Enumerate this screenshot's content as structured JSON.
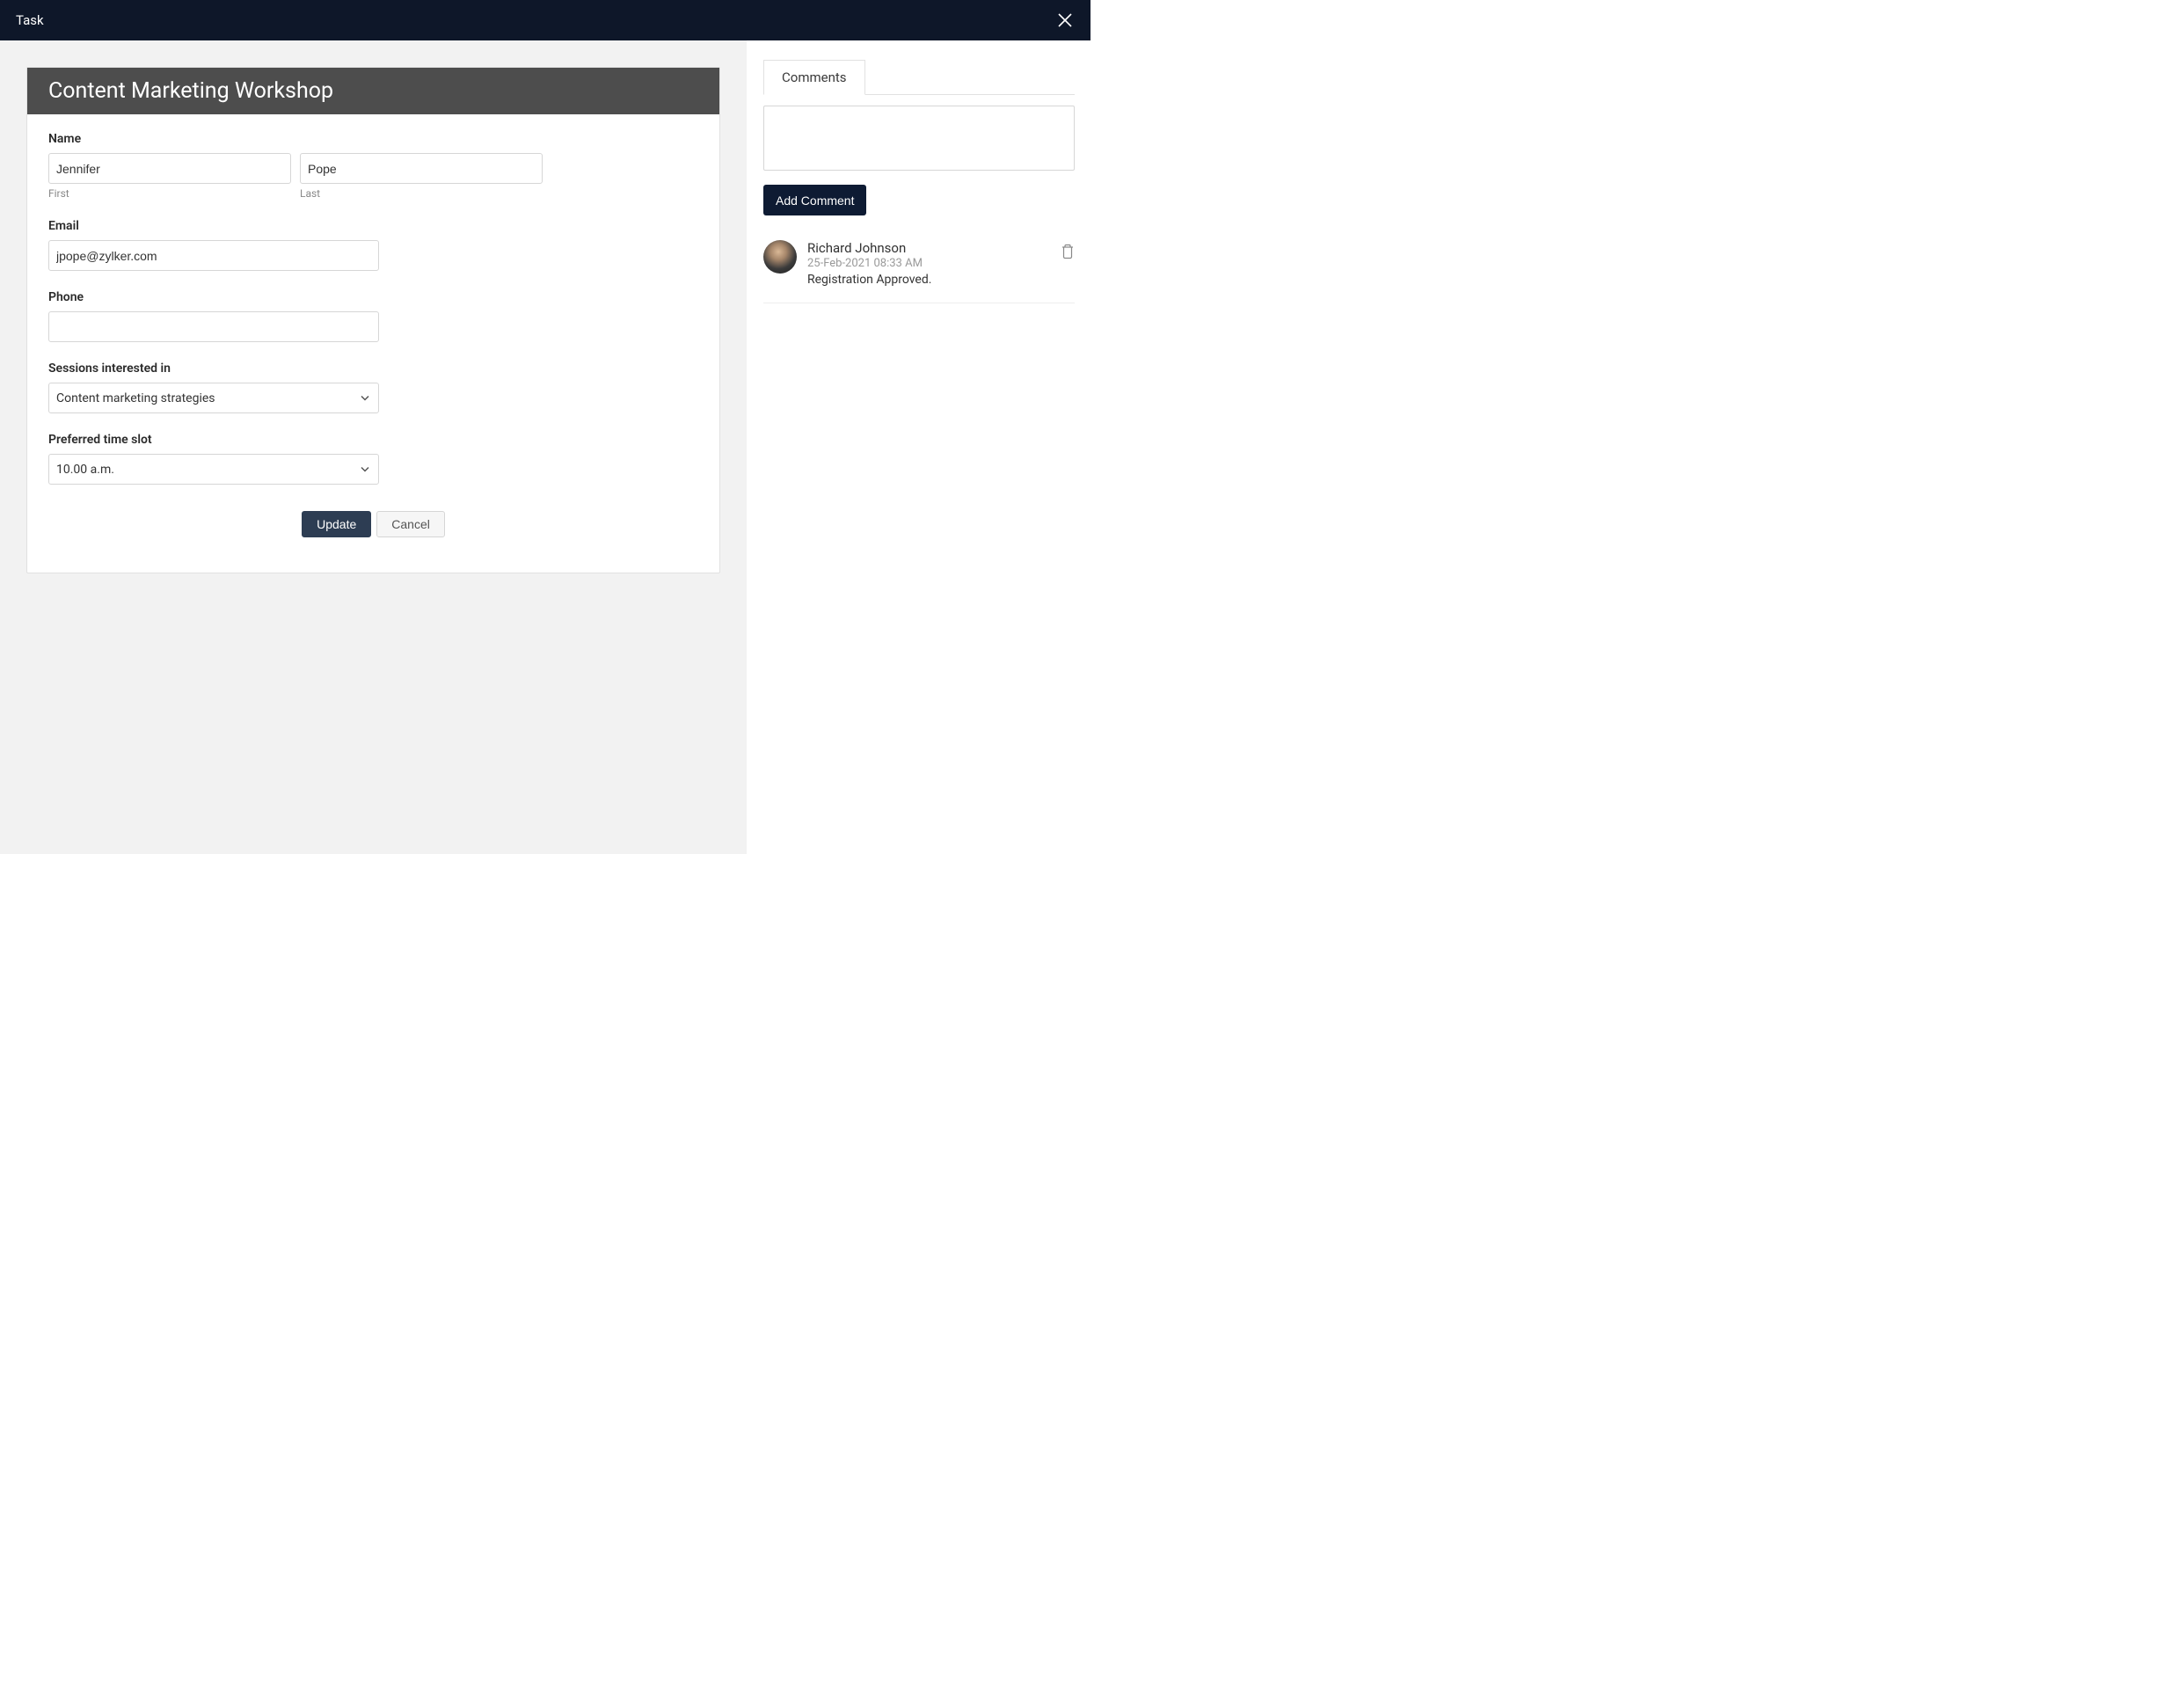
{
  "header": {
    "title": "Task"
  },
  "form": {
    "title": "Content Marketing Workshop",
    "fields": {
      "name": {
        "label": "Name",
        "first_value": "Jennifer",
        "first_sub": "First",
        "last_value": "Pope",
        "last_sub": "Last"
      },
      "email": {
        "label": "Email",
        "value": "jpope@zylker.com"
      },
      "phone": {
        "label": "Phone",
        "value": ""
      },
      "sessions": {
        "label": "Sessions interested in",
        "value": "Content marketing strategies"
      },
      "timeslot": {
        "label": "Preferred time slot",
        "value": "10.00 a.m."
      }
    },
    "buttons": {
      "update": "Update",
      "cancel": "Cancel"
    }
  },
  "comments_panel": {
    "tab_label": "Comments",
    "add_button": "Add Comment",
    "items": [
      {
        "author": "Richard Johnson",
        "date": "25-Feb-2021 08:33 AM",
        "text": "Registration Approved."
      }
    ]
  }
}
